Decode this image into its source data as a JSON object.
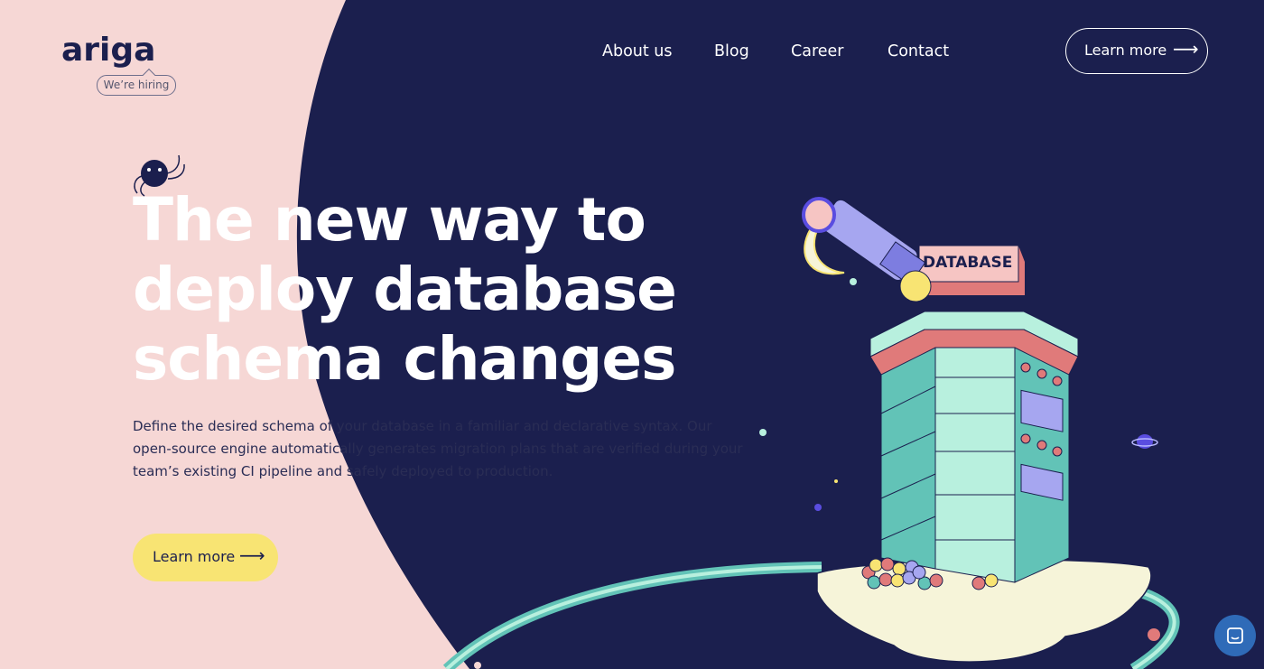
{
  "brand": {
    "logo_text": "ariga",
    "hiring_badge": "We’re hiring"
  },
  "nav": {
    "items": [
      {
        "label": "About us"
      },
      {
        "label": "Blog"
      },
      {
        "label": "Career"
      },
      {
        "label": "Contact"
      }
    ],
    "cta_label": "Learn more",
    "cta_icon": "arrow-right-icon"
  },
  "hero": {
    "title_line_1": "The new way to",
    "title_line_2": "deploy database",
    "title_line_3": "schema changes",
    "description_1": "Define the desired schema of your database in a familiar and declarative syntax. Our",
    "description_2": "open-source engine automatically generates migration plans that are verified during your",
    "description_3": "team’s existing CI pipeline and safely deployed to production.",
    "cta_label": "Learn more",
    "cta_icon": "arrow-right-icon"
  },
  "illustration": {
    "sign_text": "DATABASE"
  },
  "chat_widget": {
    "icon": "chat-icon"
  },
  "colors": {
    "navy": "#1b1f4e",
    "pink": "#f6d7d5",
    "yellow": "#f8e473",
    "mint": "#b8f0de",
    "teal": "#62c3b7",
    "coral": "#e07a7a",
    "lavender": "#a6a6f0"
  }
}
